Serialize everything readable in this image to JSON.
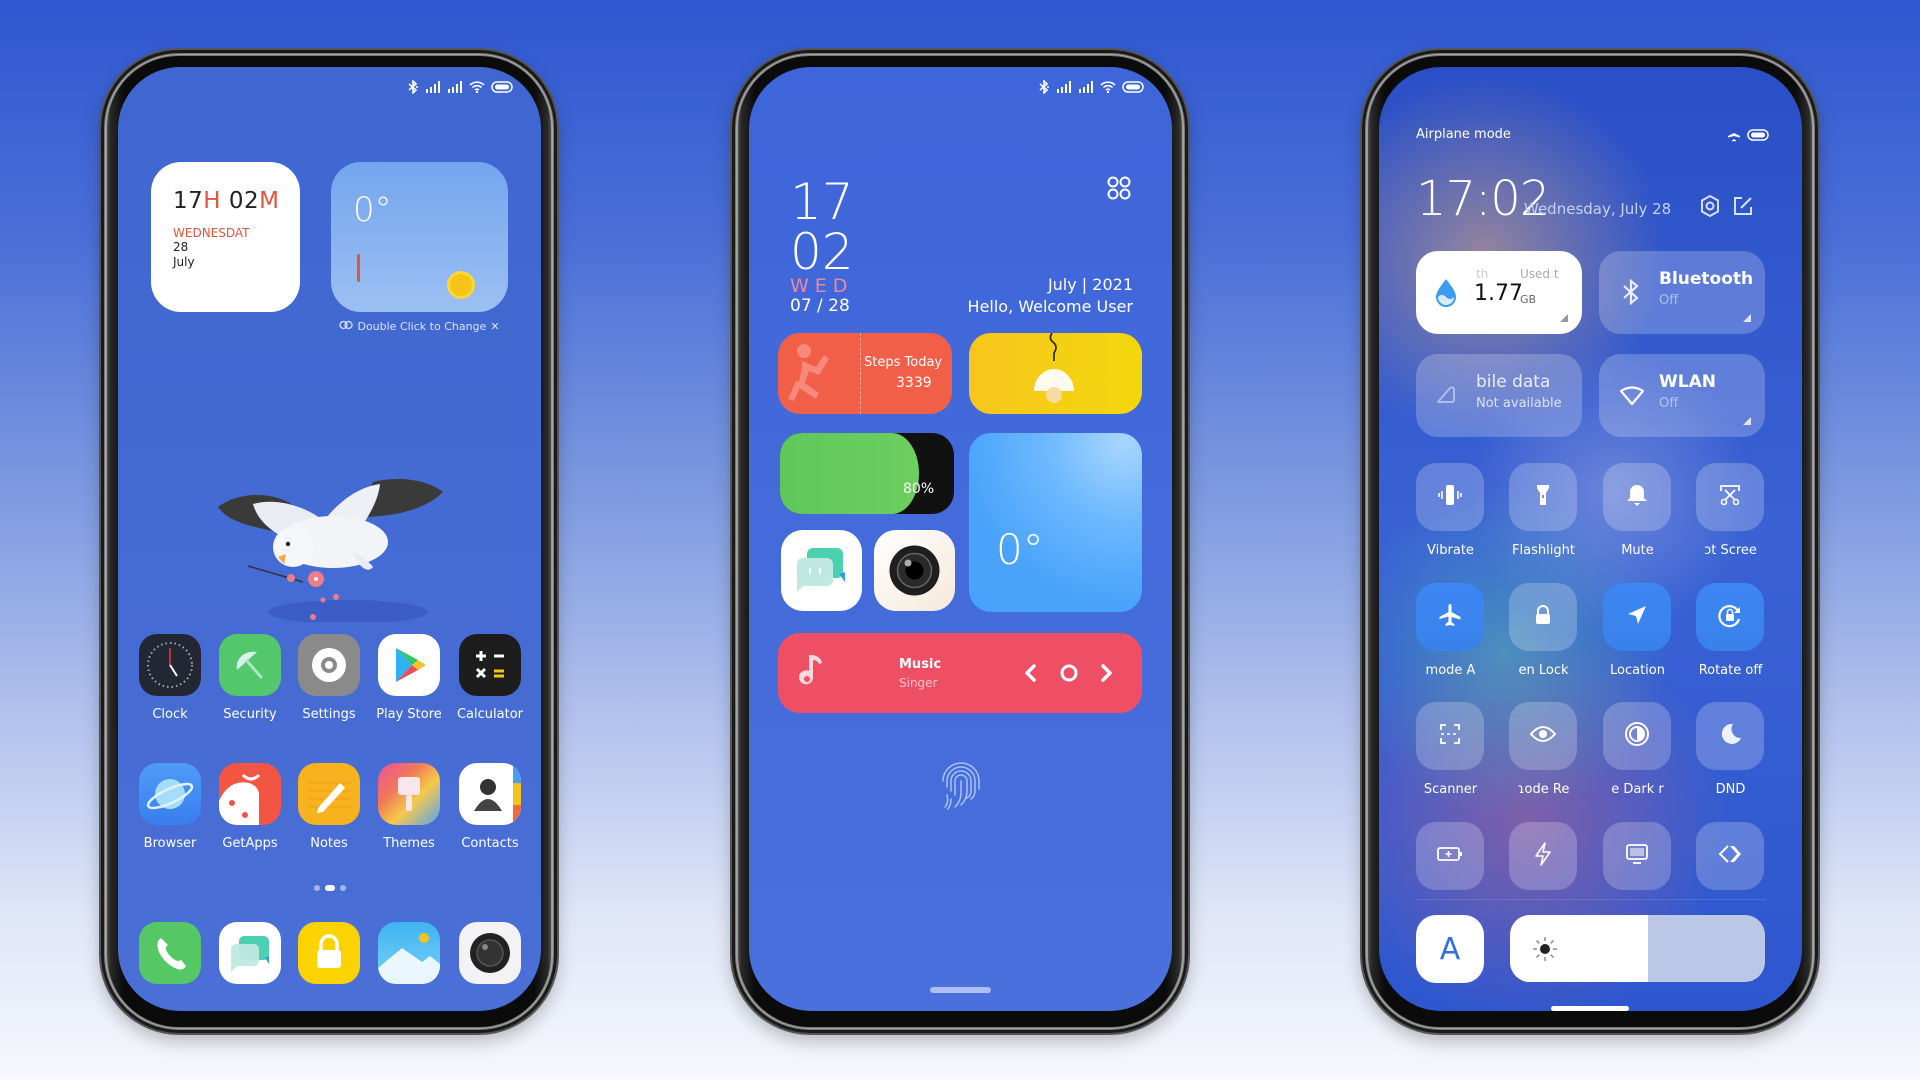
{
  "status_bar": {
    "icons": [
      "bluetooth-icon",
      "signal-icon",
      "signal-icon",
      "wifi-icon",
      "battery-icon"
    ]
  },
  "phone1": {
    "clock_widget": {
      "hour": "17",
      "hour_unit": "H",
      "minute": "02",
      "minute_unit": "M",
      "day": "WEDNESDAT",
      "date": "28",
      "month": "July"
    },
    "weather_widget": {
      "temp": "0°"
    },
    "double_click_hint": "Double Click to Change",
    "apps_row1": [
      {
        "label": "Clock",
        "icon": "clock-icon"
      },
      {
        "label": "Security",
        "icon": "security-icon"
      },
      {
        "label": "Settings",
        "icon": "settings-icon"
      },
      {
        "label": "Play Store",
        "icon": "play-store-icon"
      },
      {
        "label": "Calculator",
        "icon": "calculator-icon"
      }
    ],
    "apps_row2": [
      {
        "label": "Browser",
        "icon": "browser-icon"
      },
      {
        "label": "GetApps",
        "icon": "getapps-icon"
      },
      {
        "label": "Notes",
        "icon": "notes-icon"
      },
      {
        "label": "Themes",
        "icon": "themes-icon"
      },
      {
        "label": "Contacts",
        "icon": "contacts-icon"
      }
    ],
    "dock": [
      "phone-icon",
      "messages-icon",
      "lock-icon",
      "gallery-icon",
      "camera-icon"
    ],
    "page_indicator": {
      "pages": 3,
      "current": 2
    }
  },
  "phone2": {
    "hour": "17",
    "minute": "02",
    "weekday": "WED",
    "month_day": "07 / 28",
    "month_year": "July | 2021",
    "greeting": "Hello, Welcome User",
    "steps": {
      "label": "Steps Today",
      "value": "3339"
    },
    "battery": {
      "percent_label": "80%",
      "level": 0.8
    },
    "weather": {
      "temp": "0°"
    },
    "music": {
      "title": "Music",
      "artist": "Singer"
    }
  },
  "phone3": {
    "airplane_mode_label": "Airplane mode",
    "time": "17:02",
    "date": "Wednesday, July 28",
    "big_tiles": [
      {
        "name_partial": "th",
        "right_partial": "Used t",
        "value": "1.77",
        "unit": "GB",
        "icon": "data-usage-icon",
        "on": true
      },
      {
        "name": "Bluetooth",
        "sub": "Off",
        "icon": "bluetooth-icon",
        "on": false
      },
      {
        "name": "bile data",
        "sub": "Not available",
        "icon": "mobile-data-icon",
        "on": false
      },
      {
        "name": "WLAN",
        "sub": "Off",
        "icon": "wifi-icon",
        "on": false
      }
    ],
    "tiles": [
      {
        "label": "Vibrate",
        "icon": "vibrate-icon",
        "on": false
      },
      {
        "label": "Flashlight",
        "icon": "flashlight-icon",
        "on": false
      },
      {
        "label": "Mute",
        "icon": "bell-icon",
        "on": false
      },
      {
        "label": "ɔt    Scree",
        "icon": "screenshot-icon",
        "on": false
      },
      {
        "label": "mode    A",
        "icon": "airplane-icon",
        "on": true
      },
      {
        "label": "en    Lock",
        "icon": "lock-icon",
        "on": false
      },
      {
        "label": "Location",
        "icon": "location-icon",
        "on": true
      },
      {
        "label": "Rotate off",
        "icon": "rotate-lock-icon",
        "on": true
      },
      {
        "label": "Scanner",
        "icon": "scanner-icon",
        "on": false
      },
      {
        "label": "ɿode    Re",
        "icon": "eye-icon",
        "on": false
      },
      {
        "label": "e    Dark r",
        "icon": "dark-mode-icon",
        "on": false
      },
      {
        "label": "DND",
        "icon": "moon-icon",
        "on": false
      },
      {
        "label": "",
        "icon": "battery-saver-icon",
        "on": false
      },
      {
        "label": "",
        "icon": "lightning-icon",
        "on": false
      },
      {
        "label": "",
        "icon": "cast-screen-icon",
        "on": false
      },
      {
        "label": "",
        "icon": "nearby-share-icon",
        "on": false
      }
    ],
    "auto_brightness_label": "A",
    "brightness": 0.54
  }
}
